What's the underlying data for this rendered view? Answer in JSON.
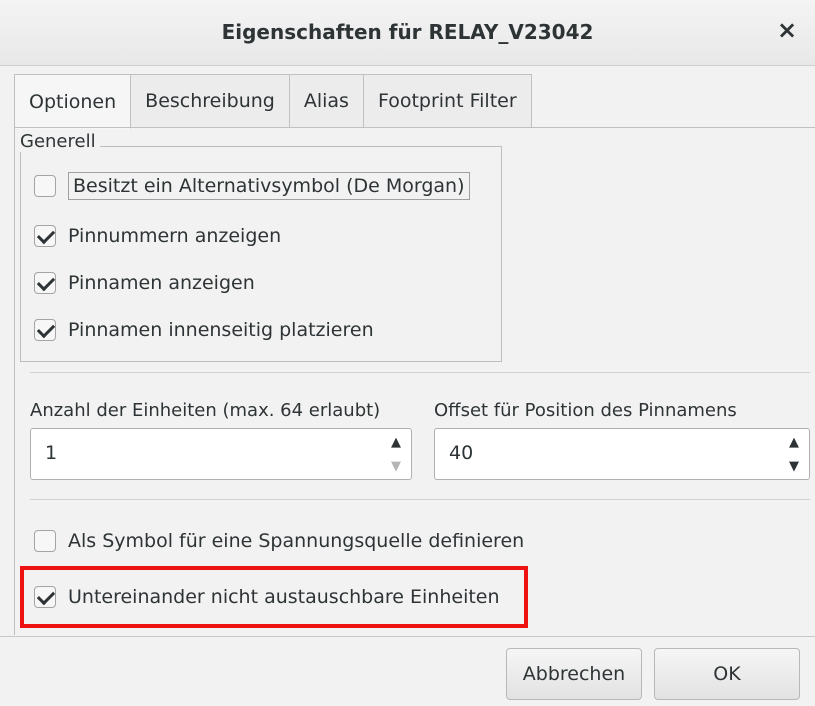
{
  "window": {
    "title": "Eigenschaften für RELAY_V23042",
    "close_glyph": "×"
  },
  "tabs": [
    {
      "label": "Optionen",
      "active": true
    },
    {
      "label": "Beschreibung",
      "active": false
    },
    {
      "label": "Alias",
      "active": false
    },
    {
      "label": "Footprint Filter",
      "active": false
    }
  ],
  "general": {
    "label": "Generell",
    "options": [
      {
        "label": "Besitzt ein Alternativsymbol (De Morgan)",
        "checked": false
      },
      {
        "label": "Pinnummern anzeigen",
        "checked": true
      },
      {
        "label": "Pinnamen anzeigen",
        "checked": true
      },
      {
        "label": "Pinnamen innenseitig platzieren",
        "checked": true
      }
    ]
  },
  "units": {
    "label": "Anzahl der Einheiten (max. 64 erlaubt)",
    "value": "1"
  },
  "pin_offset": {
    "label": "Offset für Position des Pinnamens",
    "value": "40"
  },
  "power_symbol": {
    "label": "Als Symbol für eine Spannungsquelle definieren",
    "checked": false
  },
  "not_interchangeable": {
    "label": "Untereinander nicht austauschbare Einheiten",
    "checked": true
  },
  "buttons": {
    "cancel": "Abbrechen",
    "ok": "OK"
  },
  "colors": {
    "highlight": "#ee1111"
  }
}
